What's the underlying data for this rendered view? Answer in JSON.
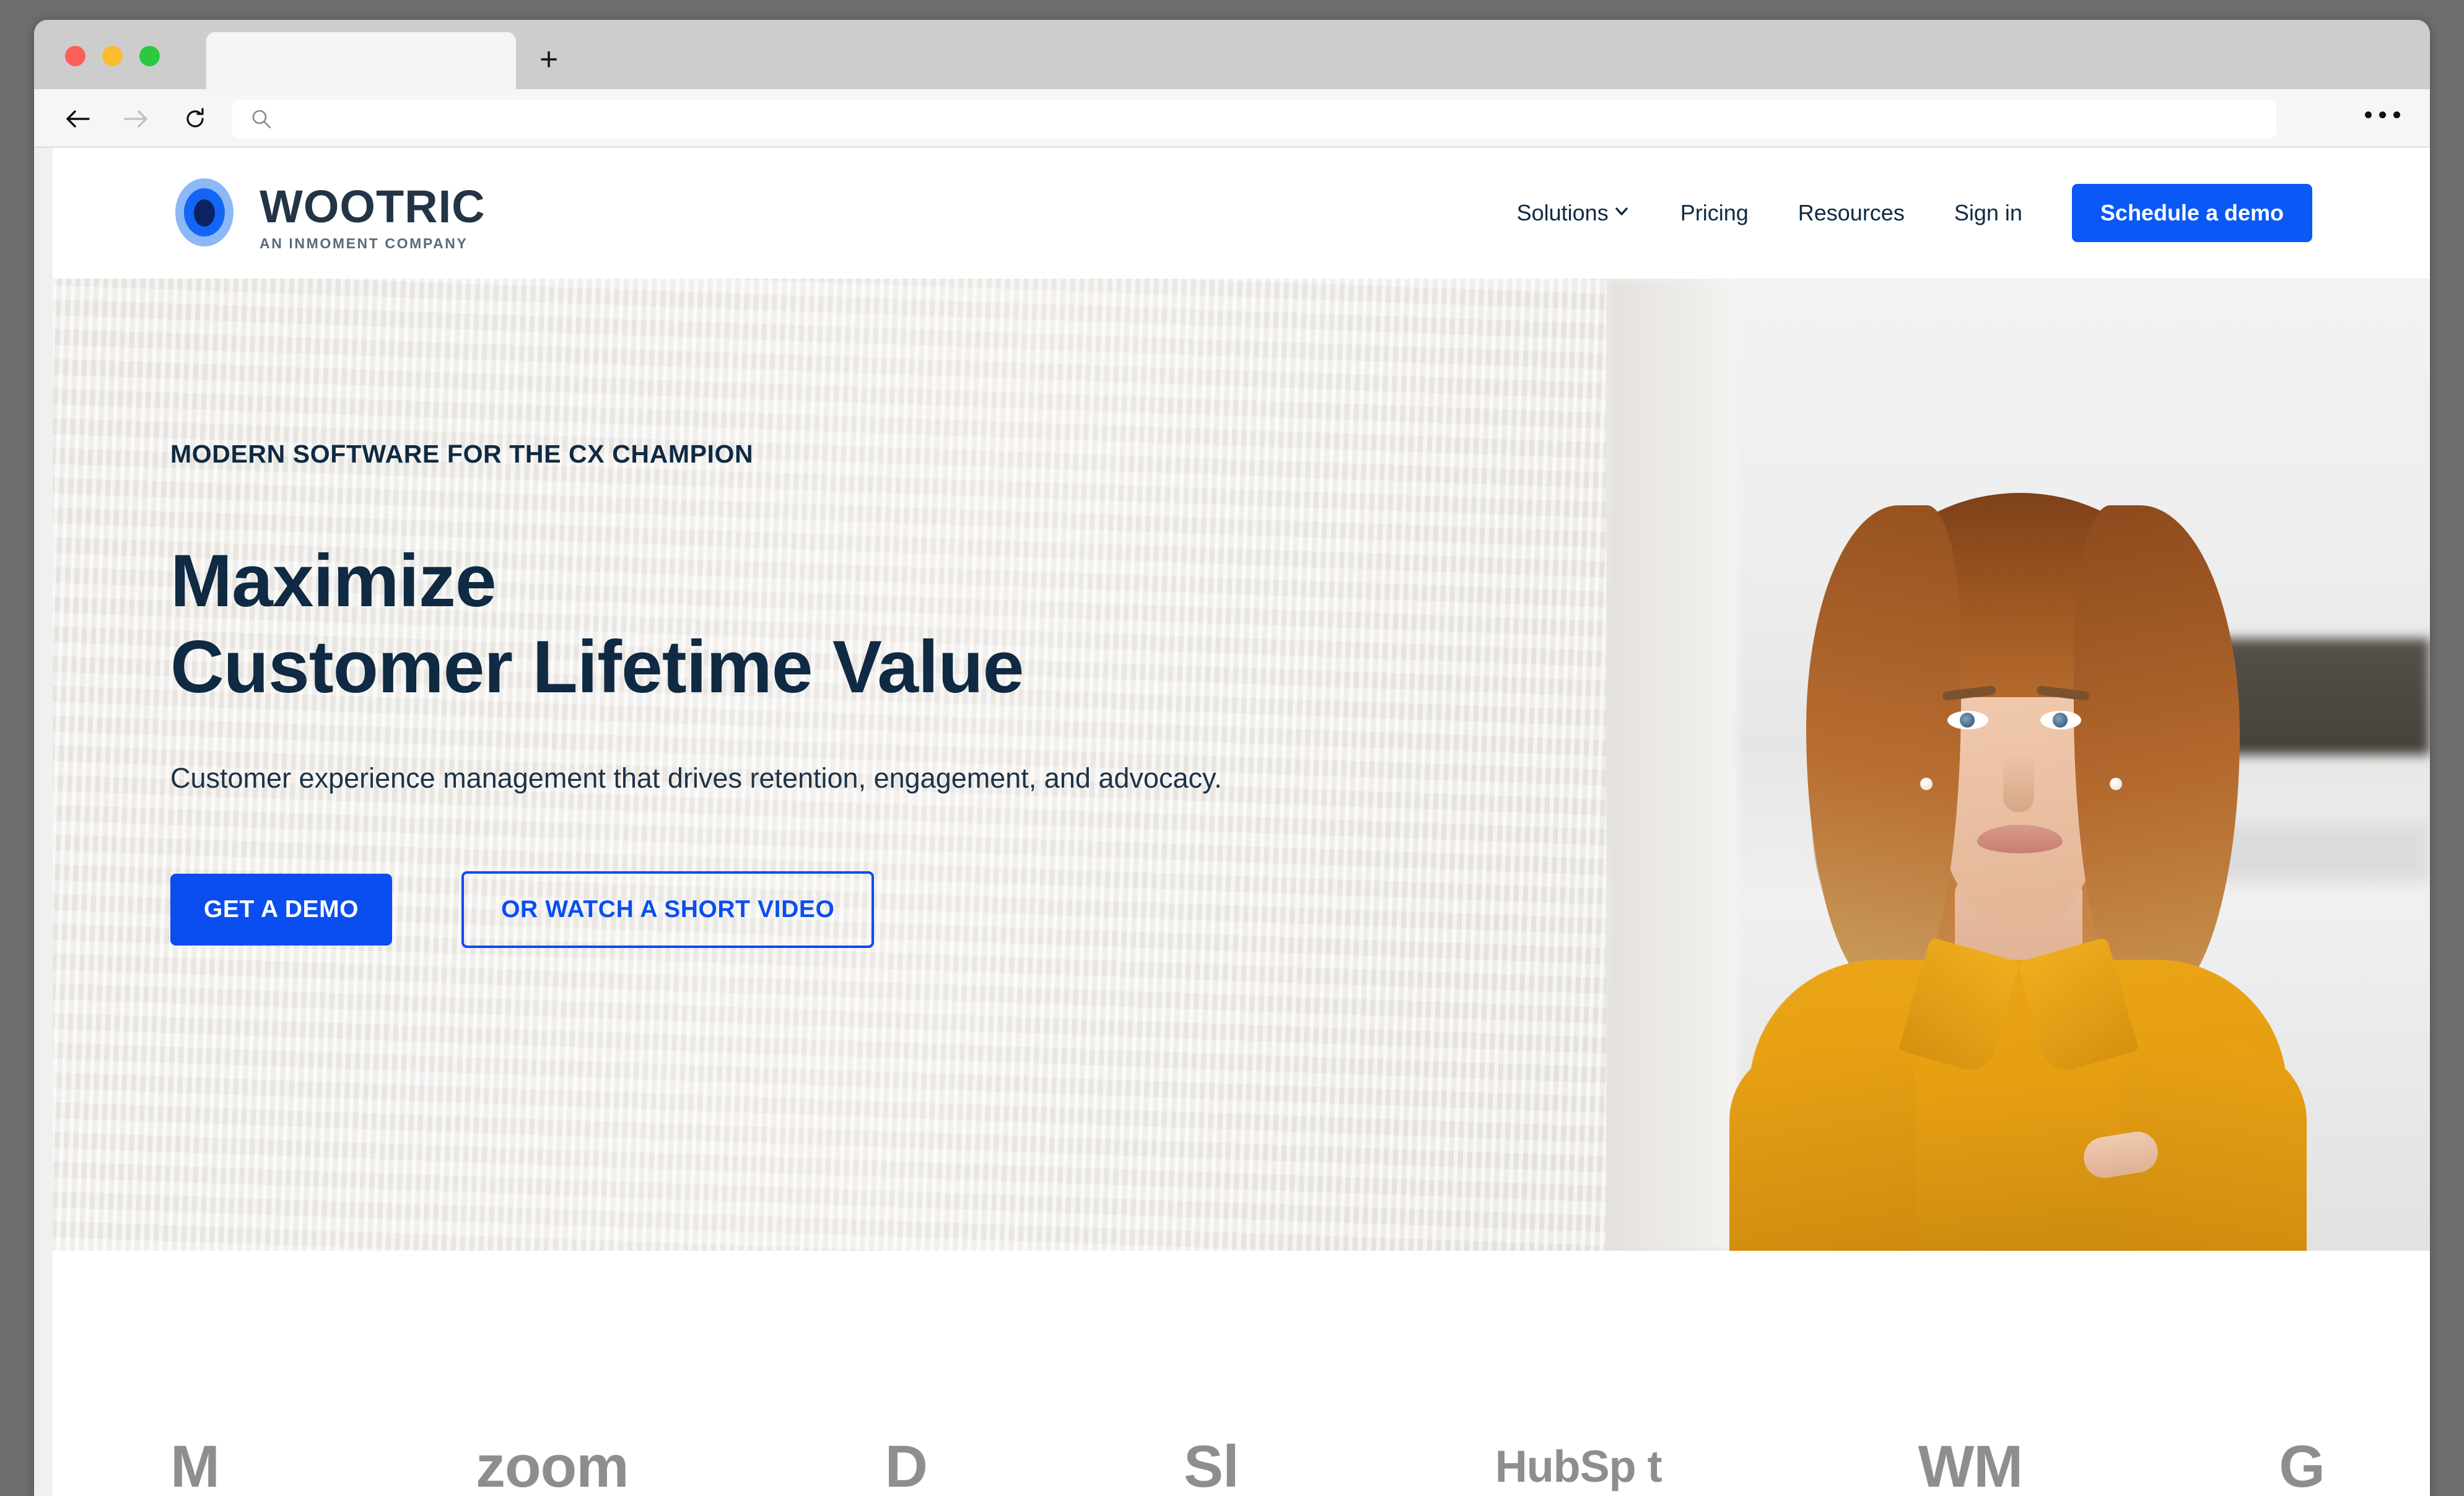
{
  "browser": {
    "tab_title": "",
    "url_value": "",
    "url_placeholder": "",
    "controls": {
      "back": "back-arrow",
      "forward": "forward-arrow",
      "reload": "reload-arrow",
      "new_tab": "+",
      "overflow": "..."
    },
    "traffic_lights": [
      "close",
      "minimize",
      "maximize"
    ]
  },
  "site": {
    "brand": {
      "name": "WOOTRIC",
      "tagline": "AN INMOMENT COMPANY",
      "logo_icon": "bullseye-icon"
    },
    "nav": [
      {
        "label": "Solutions",
        "has_chevron": true
      },
      {
        "label": "Pricing",
        "has_chevron": false
      },
      {
        "label": "Resources",
        "has_chevron": false
      },
      {
        "label": "Sign in",
        "has_chevron": false
      }
    ],
    "cta_header": "Schedule a demo"
  },
  "hero": {
    "eyebrow": "MODERN SOFTWARE FOR THE CX CHAMPION",
    "headline_line1": "Maximize",
    "headline_line2": "Customer Lifetime Value",
    "subcopy": "Customer experience management that drives retention, engagement, and advocacy.",
    "cta_primary": "GET A DEMO",
    "cta_secondary": "OR WATCH A SHORT VIDEO",
    "image_alt": "smiling-woman-in-yellow-blouse"
  },
  "logo_strip": [
    "M",
    "zoom",
    "D",
    "Sl",
    "HubSp t",
    "WM",
    "G"
  ],
  "colors": {
    "brand_blue": "#0a4ef0",
    "header_button_blue": "#0a58f5",
    "navy_text": "#0f2a42",
    "hero_bg": "#ece9e4",
    "logo_gray": "#8e8e8e",
    "blouse_yellow": "#e79f12",
    "window_chrome": "#cdcdcd"
  }
}
